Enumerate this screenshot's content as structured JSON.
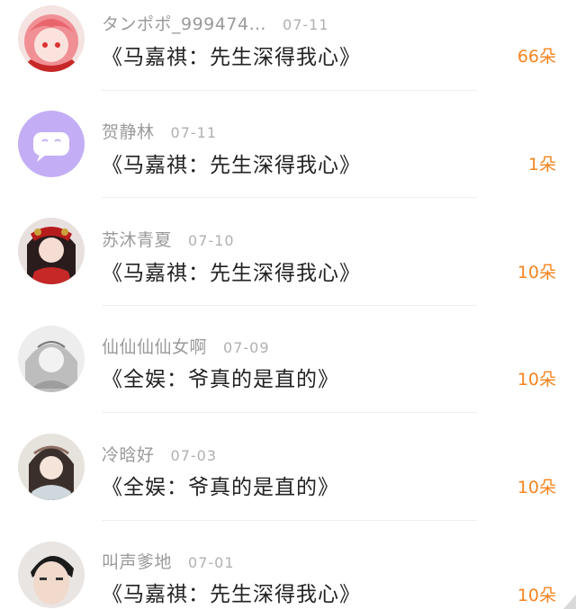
{
  "rows": [
    {
      "name": "タンポポ_999474…",
      "date": "07-11",
      "title": "《马嘉祺：先生深得我心》",
      "amount": "66朵",
      "avatar": "pink-anime-avatar"
    },
    {
      "name": "贺静林",
      "date": "07-11",
      "title": "《马嘉祺：先生深得我心》",
      "amount": "1朵",
      "avatar": "default-chat-avatar"
    },
    {
      "name": "苏沐青夏",
      "date": "07-10",
      "title": "《马嘉祺：先生深得我心》",
      "amount": "10朵",
      "avatar": "costume-girl-avatar"
    },
    {
      "name": "仙仙仙仙女啊",
      "date": "07-09",
      "title": "《全娱：爷真的是直的》",
      "amount": "10朵",
      "avatar": "sketch-portrait-avatar"
    },
    {
      "name": "冷晗好",
      "date": "07-03",
      "title": "《全娱：爷真的是直的》",
      "amount": "10朵",
      "avatar": "ancient-beauty-avatar"
    },
    {
      "name": "叫声爹地",
      "date": "07-01",
      "title": "《马嘉祺：先生深得我心》",
      "amount": "10朵",
      "avatar": "boy-photo-avatar"
    }
  ],
  "colors": {
    "amount": "#f5841f",
    "name": "#9a9a9a",
    "title": "#222222",
    "default_avatar_bg": "#c3aef6"
  }
}
